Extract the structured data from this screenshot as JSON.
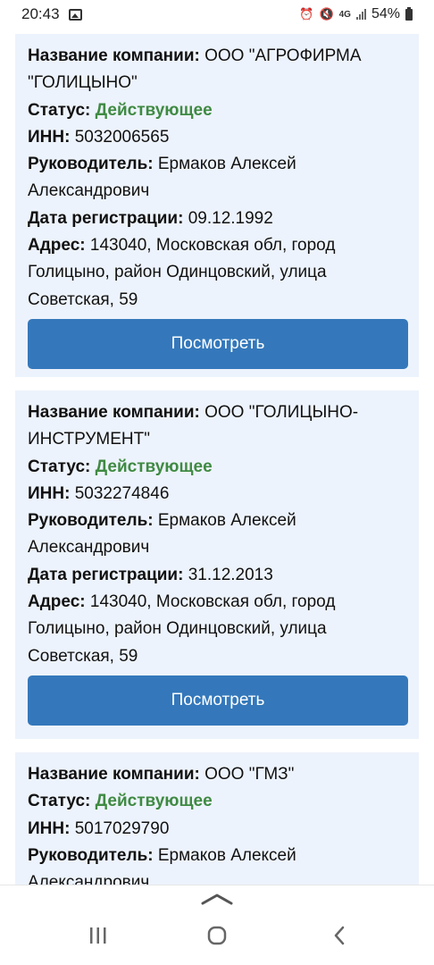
{
  "status_bar": {
    "time": "20:43",
    "network": "4G",
    "battery": "54%"
  },
  "labels": {
    "company": "Название компании:",
    "status": "Статус:",
    "inn": "ИНН:",
    "director": "Руководитель:",
    "reg_date": "Дата регистрации:",
    "address": "Адрес:"
  },
  "cards": [
    {
      "name_l1": " ООО \"АГРОФИРМА",
      "name_l2": "\"ГОЛИЦЫНО\"",
      "status": "Действующее",
      "inn": " 5032006565",
      "director_l1": " Ермаков Алексей",
      "director_l2": "Александрович",
      "reg_date": " 09.12.1992",
      "address_l1": " 143040, Московская обл, город",
      "address_l2": "Голицыно, район Одинцовский, улица",
      "address_l3": "Советская, 59",
      "button": "Посмотреть"
    },
    {
      "name_l1": " ООО \"ГОЛИЦЫНО-",
      "name_l2": "ИНСТРУМЕНТ\"",
      "status": "Действующее",
      "inn": " 5032274846",
      "director_l1": " Ермаков Алексей",
      "director_l2": "Александрович",
      "reg_date": " 31.12.2013",
      "address_l1": " 143040, Московская обл, город",
      "address_l2": "Голицыно, район Одинцовский, улица",
      "address_l3": "Советская, 59",
      "button": "Посмотреть"
    },
    {
      "name_l1": " ООО \"ГМЗ\"",
      "status": "Действующее",
      "inn": " 5017029790",
      "director_l1": " Ермаков Алексей",
      "director_l2": "Александрович"
    }
  ],
  "colors": {
    "card_bg": "#edf3fc",
    "button_bg": "#3478bb",
    "status_green": "#3f8a43"
  }
}
